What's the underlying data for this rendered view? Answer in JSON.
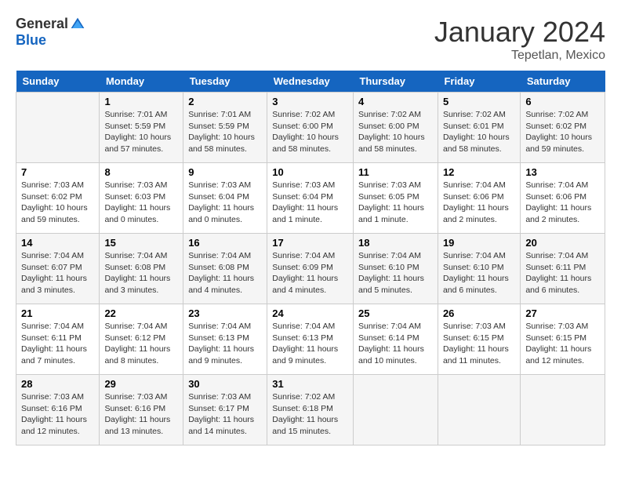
{
  "header": {
    "logo_general": "General",
    "logo_blue": "Blue",
    "month_title": "January 2024",
    "subtitle": "Tepetlan, Mexico"
  },
  "days_of_week": [
    "Sunday",
    "Monday",
    "Tuesday",
    "Wednesday",
    "Thursday",
    "Friday",
    "Saturday"
  ],
  "weeks": [
    [
      {
        "day": "",
        "info": ""
      },
      {
        "day": "1",
        "info": "Sunrise: 7:01 AM\nSunset: 5:59 PM\nDaylight: 10 hours\nand 57 minutes."
      },
      {
        "day": "2",
        "info": "Sunrise: 7:01 AM\nSunset: 5:59 PM\nDaylight: 10 hours\nand 58 minutes."
      },
      {
        "day": "3",
        "info": "Sunrise: 7:02 AM\nSunset: 6:00 PM\nDaylight: 10 hours\nand 58 minutes."
      },
      {
        "day": "4",
        "info": "Sunrise: 7:02 AM\nSunset: 6:00 PM\nDaylight: 10 hours\nand 58 minutes."
      },
      {
        "day": "5",
        "info": "Sunrise: 7:02 AM\nSunset: 6:01 PM\nDaylight: 10 hours\nand 58 minutes."
      },
      {
        "day": "6",
        "info": "Sunrise: 7:02 AM\nSunset: 6:02 PM\nDaylight: 10 hours\nand 59 minutes."
      }
    ],
    [
      {
        "day": "7",
        "info": "Sunrise: 7:03 AM\nSunset: 6:02 PM\nDaylight: 10 hours\nand 59 minutes."
      },
      {
        "day": "8",
        "info": "Sunrise: 7:03 AM\nSunset: 6:03 PM\nDaylight: 11 hours\nand 0 minutes."
      },
      {
        "day": "9",
        "info": "Sunrise: 7:03 AM\nSunset: 6:04 PM\nDaylight: 11 hours\nand 0 minutes."
      },
      {
        "day": "10",
        "info": "Sunrise: 7:03 AM\nSunset: 6:04 PM\nDaylight: 11 hours\nand 1 minute."
      },
      {
        "day": "11",
        "info": "Sunrise: 7:03 AM\nSunset: 6:05 PM\nDaylight: 11 hours\nand 1 minute."
      },
      {
        "day": "12",
        "info": "Sunrise: 7:04 AM\nSunset: 6:06 PM\nDaylight: 11 hours\nand 2 minutes."
      },
      {
        "day": "13",
        "info": "Sunrise: 7:04 AM\nSunset: 6:06 PM\nDaylight: 11 hours\nand 2 minutes."
      }
    ],
    [
      {
        "day": "14",
        "info": "Sunrise: 7:04 AM\nSunset: 6:07 PM\nDaylight: 11 hours\nand 3 minutes."
      },
      {
        "day": "15",
        "info": "Sunrise: 7:04 AM\nSunset: 6:08 PM\nDaylight: 11 hours\nand 3 minutes."
      },
      {
        "day": "16",
        "info": "Sunrise: 7:04 AM\nSunset: 6:08 PM\nDaylight: 11 hours\nand 4 minutes."
      },
      {
        "day": "17",
        "info": "Sunrise: 7:04 AM\nSunset: 6:09 PM\nDaylight: 11 hours\nand 4 minutes."
      },
      {
        "day": "18",
        "info": "Sunrise: 7:04 AM\nSunset: 6:10 PM\nDaylight: 11 hours\nand 5 minutes."
      },
      {
        "day": "19",
        "info": "Sunrise: 7:04 AM\nSunset: 6:10 PM\nDaylight: 11 hours\nand 6 minutes."
      },
      {
        "day": "20",
        "info": "Sunrise: 7:04 AM\nSunset: 6:11 PM\nDaylight: 11 hours\nand 6 minutes."
      }
    ],
    [
      {
        "day": "21",
        "info": "Sunrise: 7:04 AM\nSunset: 6:11 PM\nDaylight: 11 hours\nand 7 minutes."
      },
      {
        "day": "22",
        "info": "Sunrise: 7:04 AM\nSunset: 6:12 PM\nDaylight: 11 hours\nand 8 minutes."
      },
      {
        "day": "23",
        "info": "Sunrise: 7:04 AM\nSunset: 6:13 PM\nDaylight: 11 hours\nand 9 minutes."
      },
      {
        "day": "24",
        "info": "Sunrise: 7:04 AM\nSunset: 6:13 PM\nDaylight: 11 hours\nand 9 minutes."
      },
      {
        "day": "25",
        "info": "Sunrise: 7:04 AM\nSunset: 6:14 PM\nDaylight: 11 hours\nand 10 minutes."
      },
      {
        "day": "26",
        "info": "Sunrise: 7:03 AM\nSunset: 6:15 PM\nDaylight: 11 hours\nand 11 minutes."
      },
      {
        "day": "27",
        "info": "Sunrise: 7:03 AM\nSunset: 6:15 PM\nDaylight: 11 hours\nand 12 minutes."
      }
    ],
    [
      {
        "day": "28",
        "info": "Sunrise: 7:03 AM\nSunset: 6:16 PM\nDaylight: 11 hours\nand 12 minutes."
      },
      {
        "day": "29",
        "info": "Sunrise: 7:03 AM\nSunset: 6:16 PM\nDaylight: 11 hours\nand 13 minutes."
      },
      {
        "day": "30",
        "info": "Sunrise: 7:03 AM\nSunset: 6:17 PM\nDaylight: 11 hours\nand 14 minutes."
      },
      {
        "day": "31",
        "info": "Sunrise: 7:02 AM\nSunset: 6:18 PM\nDaylight: 11 hours\nand 15 minutes."
      },
      {
        "day": "",
        "info": ""
      },
      {
        "day": "",
        "info": ""
      },
      {
        "day": "",
        "info": ""
      }
    ]
  ]
}
